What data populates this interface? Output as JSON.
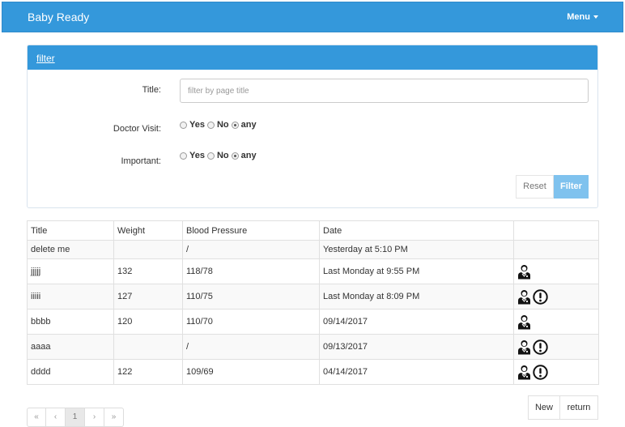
{
  "app": {
    "brand": "Baby Ready",
    "menu_label": "Menu"
  },
  "filter": {
    "heading": "filter",
    "title_label": "Title:",
    "title_placeholder": "filter by page title",
    "title_value": "",
    "doctor_visit": {
      "label": "Doctor Visit:",
      "options": [
        "Yes",
        "No",
        "any"
      ],
      "selected": "any"
    },
    "important": {
      "label": "Important:",
      "options": [
        "Yes",
        "No",
        "any"
      ],
      "selected": "any"
    },
    "reset_label": "Reset",
    "filter_label": "Filter"
  },
  "table": {
    "columns": [
      "Title",
      "Weight",
      "Blood Pressure",
      "Date",
      ""
    ],
    "rows": [
      {
        "title": "delete me",
        "weight": "",
        "bp": "/",
        "date": "Yesterday at 5:10 PM",
        "doctor": false,
        "important": false
      },
      {
        "title": "jjjjj",
        "weight": "132",
        "bp": "118/78",
        "date": "Last Monday at 9:55 PM",
        "doctor": true,
        "important": false
      },
      {
        "title": "iiiii",
        "weight": "127",
        "bp": "110/75",
        "date": "Last Monday at 8:09 PM",
        "doctor": true,
        "important": true
      },
      {
        "title": "bbbb",
        "weight": "120",
        "bp": "110/70",
        "date": "09/14/2017",
        "doctor": true,
        "important": false
      },
      {
        "title": "aaaa",
        "weight": "",
        "bp": "/",
        "date": "09/13/2017",
        "doctor": true,
        "important": true
      },
      {
        "title": "dddd",
        "weight": "122",
        "bp": "109/69",
        "date": "04/14/2017",
        "doctor": true,
        "important": true
      }
    ]
  },
  "actions": {
    "new_label": "New",
    "return_label": "return"
  },
  "pagination": {
    "items": [
      "«",
      "‹",
      "1",
      "›",
      "»"
    ],
    "current": "1"
  },
  "icons": {
    "doctor": "doctor-icon",
    "important": "exclamation-circle-icon"
  }
}
